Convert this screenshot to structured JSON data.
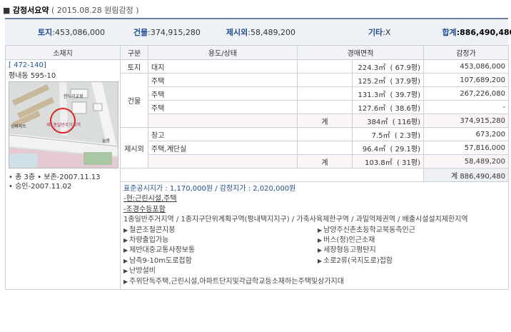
{
  "header": {
    "bullet": "■",
    "title": "감정서요약",
    "date_note": "( 2015.08.28 원림감정 )"
  },
  "summary": {
    "land_label": "토지",
    "land_value": ":453,086,000",
    "building_label": "건물",
    "building_value": ":374,915,280",
    "extra_label": "제시외",
    "extra_value": ":58,489,200",
    "other_label": "기타",
    "other_value": ":X",
    "total_label": "합계",
    "total_value": ":886,490,480"
  },
  "table": {
    "headers": [
      "소재지",
      "구분",
      "용도/상태",
      "경매면적",
      "감정가"
    ],
    "location": {
      "code": "[ 472-140]",
      "address": "평내동 595-10",
      "bullets": [
        "• 총 3층 • 보존-2007.11.13",
        "• 승인-2007.11.02"
      ],
      "map_labels": [
        "한누리교회",
        "장마파트",
        "늘봄"
      ]
    },
    "groups": {
      "land": "토지",
      "building": "건물",
      "extra": "제시외"
    },
    "rows": [
      {
        "use": "대지",
        "area": "224.3㎡",
        "pyeong": "( 67.9평)",
        "price": "453,086,000"
      },
      {
        "use": "주택",
        "area": "125.2㎡",
        "pyeong": "( 37.9평)",
        "price": "107,689,200"
      },
      {
        "use": "주택",
        "area": "131.3㎡",
        "pyeong": "( 39.7평)",
        "price": "267,226,080"
      },
      {
        "use": "주택",
        "area": "127.6㎡",
        "pyeong": "( 38.6평)",
        "price": "-"
      },
      {
        "sub_label": "계",
        "area": "384㎡",
        "pyeong": "( 116평)",
        "price": "374,915,280"
      },
      {
        "use": "창고",
        "area": "7.5㎡",
        "pyeong": "( 2.3평)",
        "price": "673,200"
      },
      {
        "use": "주택,계단실",
        "area": "96.4㎡",
        "pyeong": "( 29.1평)",
        "price": "57,816,000"
      },
      {
        "sub_label": "계",
        "area": "103.8㎡",
        "pyeong": "( 31평)",
        "price": "58,489,200"
      }
    ],
    "grand_total": "계 886,490,480"
  },
  "info": {
    "price_line": "표준공시지가 : 1,170,000원 / 감정지가 : 2,020,000원",
    "current": "-현:근린시설,주택",
    "inspection": "-조경수등포함",
    "zoning": "1종일반주거지역 / 1종지구단위계획구역(평내택지지구) / 가축사육제한구역 / 과밀억제권역 / 배출시설설치제한지역",
    "features": [
      "철콘조철콘지붕",
      "남양주신촌초등학교북동측인근",
      "차량출입가능",
      "버스(정)인근소재",
      "제반대중교통사정보통",
      "세장형등고평탄지",
      "남측9-10m도로접함",
      "소로2류(국지도로)접함",
      "난방설비",
      "주위단독주택,근린시설,아파트단지및각급학교등소재하는주택및상가지대"
    ]
  }
}
